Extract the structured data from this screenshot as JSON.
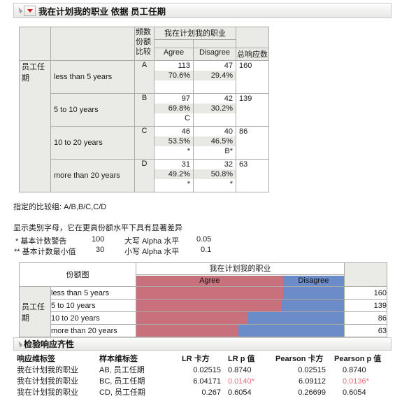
{
  "outline": {
    "title": "我在计划我的职业 依据 员工任期",
    "disclosure_icon": "triangle-collapse-icon",
    "menu_icon": "red-dropdown-icon"
  },
  "contingency": {
    "stat_labels": [
      "频数",
      "份额",
      "比较"
    ],
    "col_group_title": "我在计划我的职业",
    "columns": [
      "Agree",
      "Disagree"
    ],
    "total_col": "总响应数",
    "row_group_title": "员工任期",
    "rows": [
      {
        "label": "less than 5 years",
        "letter": "A",
        "cells": [
          {
            "count": "113",
            "pct": "70.6%",
            "cmp": ""
          },
          {
            "count": "47",
            "pct": "29.4%",
            "cmp": ""
          }
        ],
        "total": "160"
      },
      {
        "label": "5 to 10 years",
        "letter": "B",
        "cells": [
          {
            "count": "97",
            "pct": "69.8%",
            "cmp": "C"
          },
          {
            "count": "42",
            "pct": "30.2%",
            "cmp": ""
          }
        ],
        "total": "139"
      },
      {
        "label": "10 to 20 years",
        "letter": "C",
        "cells": [
          {
            "count": "46",
            "pct": "53.5%",
            "cmp": "*"
          },
          {
            "count": "40",
            "pct": "46.5%",
            "cmp": "B*"
          }
        ],
        "total": "86"
      },
      {
        "label": "more than 20 years",
        "letter": "D",
        "cells": [
          {
            "count": "31",
            "pct": "49.2%",
            "cmp": "*"
          },
          {
            "count": "32",
            "pct": "50.8%",
            "cmp": "*"
          }
        ],
        "total": "63"
      }
    ]
  },
  "notes": {
    "comparison_groups": "指定的比较组: A/B,B/C,C/D",
    "legend_line": "显示类别字母，它在更高份额水平下具有显著差异",
    "warn_label": "*  基本计数警告",
    "warn_value": "100",
    "upper_alpha_label": "大写 Alpha 水平",
    "upper_alpha_value": "0.05",
    "min_label": "** 基本计数最小值",
    "min_value": "30",
    "lower_alpha_label": "小写 Alpha 水平",
    "lower_alpha_value": "0.1"
  },
  "chart_data": {
    "type": "bar",
    "title": "份额图",
    "stacked": true,
    "orientation": "horizontal",
    "normalized": true,
    "group_title": "我在计划我的职业",
    "row_group_title": "员工任期",
    "legend": [
      "Agree",
      "Disagree"
    ],
    "colors": {
      "Agree": "#c8717d",
      "Disagree": "#6c8bc9"
    },
    "categories": [
      "less than 5 years",
      "5 to 10 years",
      "10 to 20 years",
      "more than 20 years"
    ],
    "series": [
      {
        "name": "Agree",
        "values": [
          70.6,
          69.8,
          53.5,
          49.2
        ]
      },
      {
        "name": "Disagree",
        "values": [
          29.4,
          30.2,
          46.5,
          50.8
        ]
      }
    ],
    "counts": [
      "160",
      "139",
      "86",
      "63"
    ],
    "xlabel": "",
    "ylabel": "",
    "xlim": [
      0,
      100
    ],
    "grid": false,
    "legend_position": "top"
  },
  "tests": {
    "section_title": "检验响应齐性",
    "disclosure_icon": "triangle-collapse-icon",
    "headers": [
      "响应维标签",
      "样本维标签",
      "LR 卡方",
      "LR p 值",
      "Pearson 卡方",
      "Pearson p 值"
    ],
    "rows": [
      {
        "response": "我在计划我的职业",
        "sample": "AB, 员工任期",
        "lr_chisq": "0.02515",
        "lr_p": "0.8740",
        "lr_p_sig": false,
        "pearson_chisq": "0.02515",
        "pearson_p": "0.8740",
        "pearson_p_sig": false
      },
      {
        "response": "我在计划我的职业",
        "sample": "BC, 员工任期",
        "lr_chisq": "6.04171",
        "lr_p": "0.0140*",
        "lr_p_sig": true,
        "pearson_chisq": "6.09112",
        "pearson_p": "0.0136*",
        "pearson_p_sig": true
      },
      {
        "response": "我在计划我的职业",
        "sample": "CD, 员工任期",
        "lr_chisq": "0.267",
        "lr_p": "0.6054",
        "lr_p_sig": false,
        "pearson_chisq": "0.26699",
        "pearson_p": "0.6054",
        "pearson_p_sig": false
      }
    ]
  }
}
